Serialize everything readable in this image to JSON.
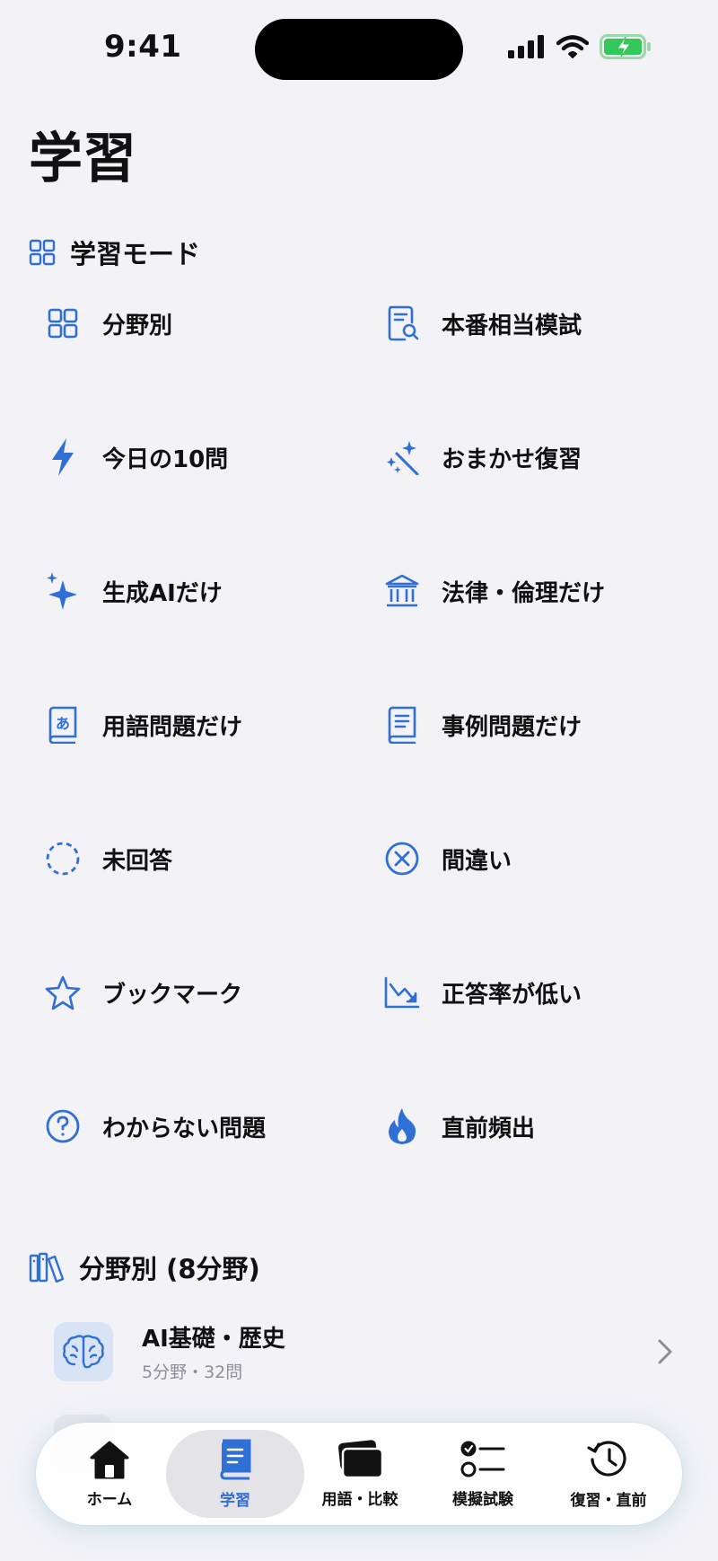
{
  "status_bar": {
    "time": "9:41"
  },
  "page": {
    "title": "学習"
  },
  "mode_section": {
    "title": "学習モード"
  },
  "modes": [
    {
      "label": "分野別",
      "icon": "grid-icon"
    },
    {
      "label": "本番相当模試",
      "icon": "document-search-icon"
    },
    {
      "label": "今日の10問",
      "icon": "bolt-icon"
    },
    {
      "label": "おまかせ復習",
      "icon": "magic-wand-icon"
    },
    {
      "label": "生成AIだけ",
      "icon": "sparkles-icon"
    },
    {
      "label": "法律・倫理だけ",
      "icon": "bank-icon"
    },
    {
      "label": "用語問題だけ",
      "icon": "dictionary-book-icon"
    },
    {
      "label": "事例問題だけ",
      "icon": "book-icon"
    },
    {
      "label": "未回答",
      "icon": "dashed-circle-icon"
    },
    {
      "label": "間違い",
      "icon": "x-circle-icon"
    },
    {
      "label": "ブックマーク",
      "icon": "star-icon"
    },
    {
      "label": "正答率が低い",
      "icon": "chart-down-icon"
    },
    {
      "label": "わからない問題",
      "icon": "question-circle-icon"
    },
    {
      "label": "直前頻出",
      "icon": "flame-icon"
    }
  ],
  "category_section": {
    "title": "分野別 (8分野)"
  },
  "categories": [
    {
      "title": "AI基礎・歴史",
      "subtitle": "5分野・32問",
      "icon": "brain-icon"
    }
  ],
  "tabs": [
    {
      "label": "ホーム",
      "icon": "house-icon",
      "active": false
    },
    {
      "label": "学習",
      "icon": "book-icon",
      "active": true
    },
    {
      "label": "用語・比較",
      "icon": "cards-icon",
      "active": false
    },
    {
      "label": "模擬試験",
      "icon": "checklist-icon",
      "active": false
    },
    {
      "label": "復習・直前",
      "icon": "history-icon",
      "active": false
    }
  ],
  "colors": {
    "accent": "#2f6fd6",
    "background": "#f2f2f7",
    "battery": "#34c759"
  }
}
